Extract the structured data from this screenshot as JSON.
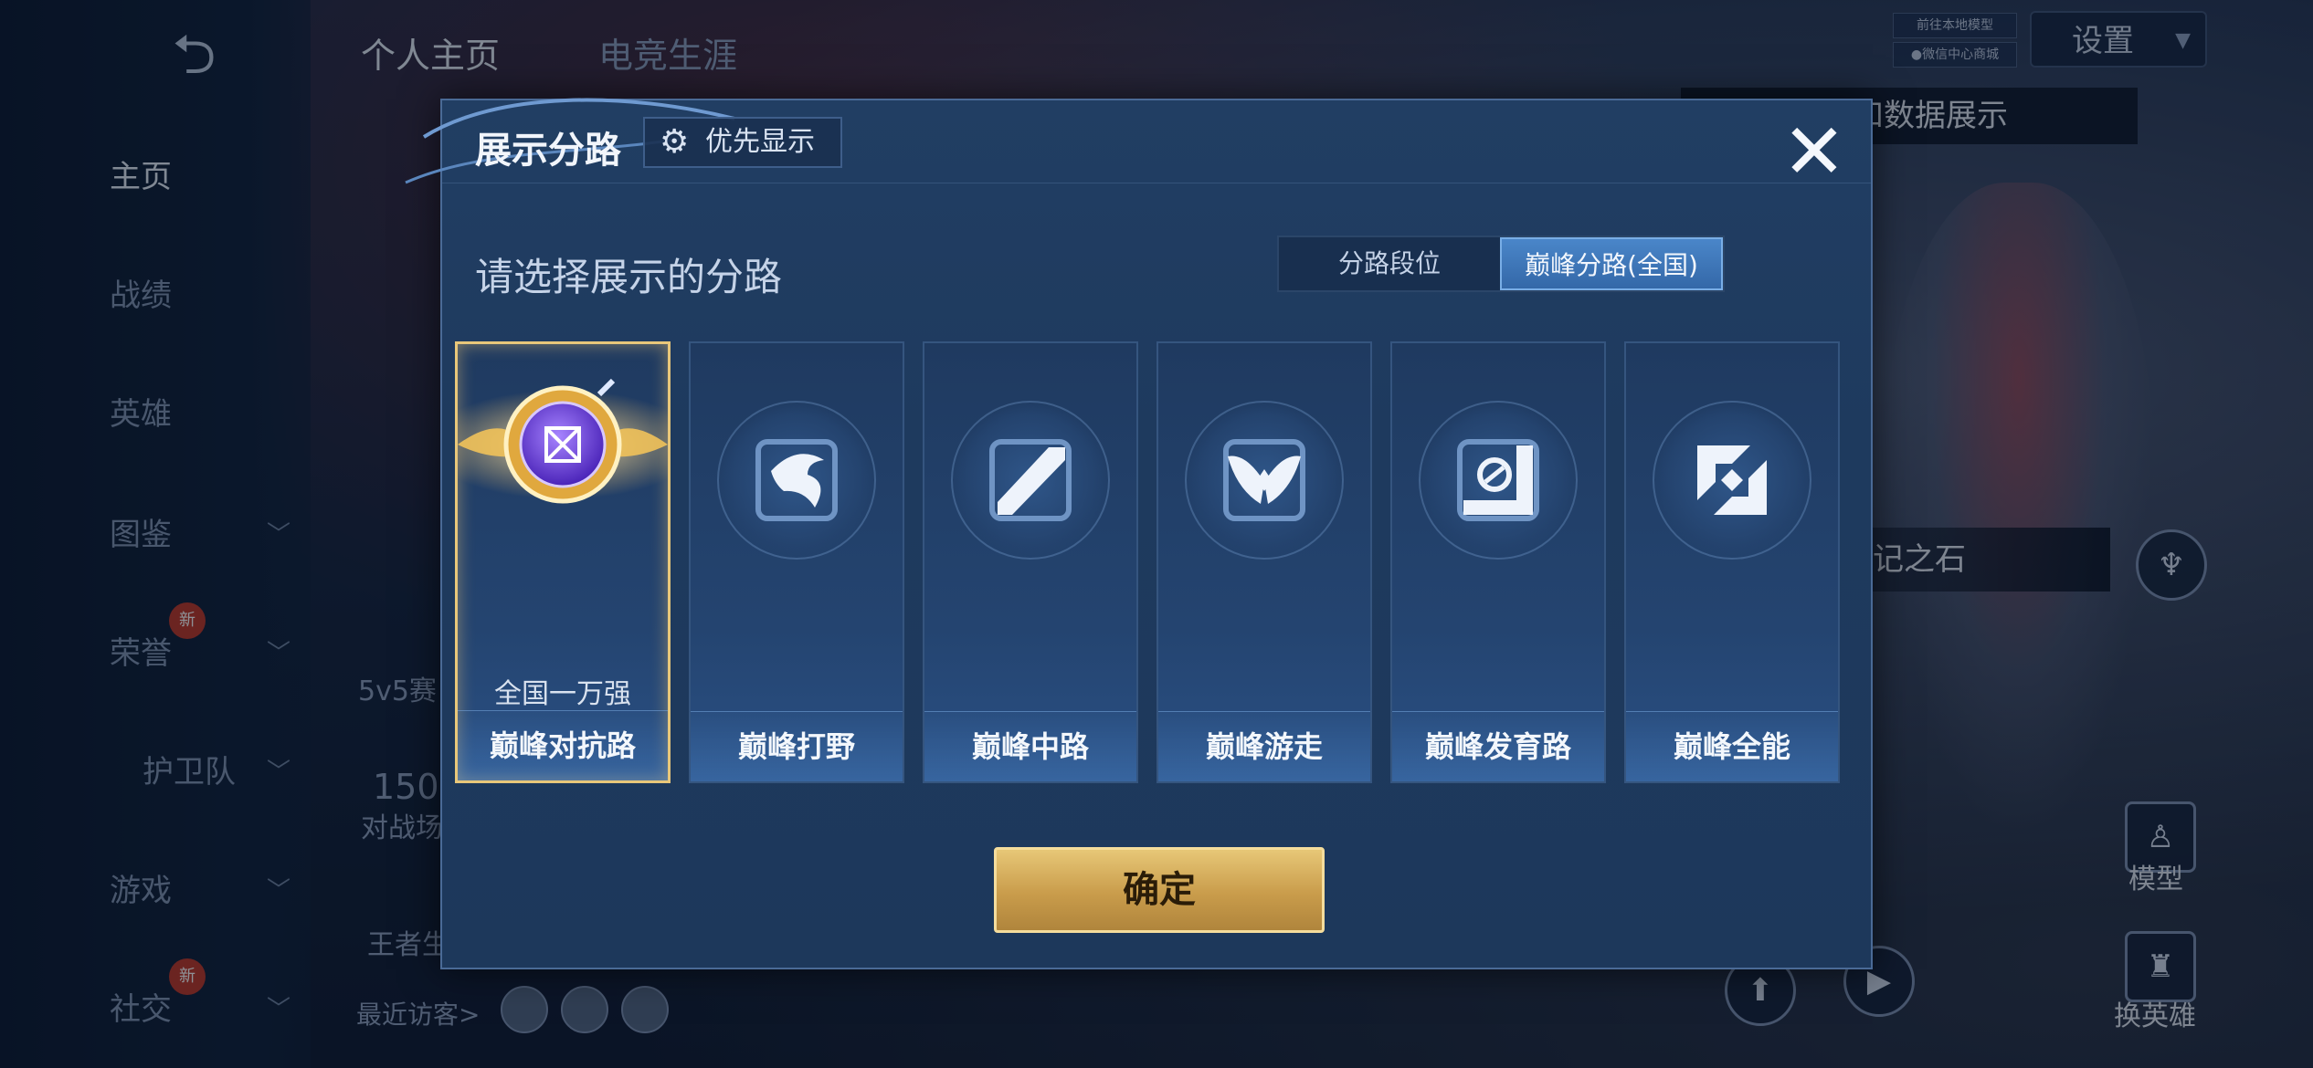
{
  "app": {
    "top_tabs": [
      "个人主页",
      "电竞生涯"
    ],
    "settings_label": "设置",
    "mini_tags": [
      "前往本地模型",
      "●微信中心商城"
    ],
    "hint_banner": "可切换灵宝和数据展示",
    "hint_mark": "点击查看铭记之石",
    "bottom_labels": {
      "model": "模型",
      "swap_hero": "换英雄"
    }
  },
  "sidebar": {
    "back_icon": "back-arrow-icon",
    "items": [
      {
        "label": "主页",
        "active": true,
        "chevron": false,
        "new": false
      },
      {
        "label": "战绩",
        "active": false,
        "chevron": false,
        "new": false
      },
      {
        "label": "英雄",
        "active": false,
        "chevron": false,
        "new": false
      },
      {
        "label": "图鉴",
        "active": false,
        "chevron": true,
        "new": false
      },
      {
        "label": "荣誉",
        "active": false,
        "chevron": true,
        "new": true
      },
      {
        "label": "护卫队",
        "active": false,
        "chevron": true,
        "new": false
      },
      {
        "label": "游戏",
        "active": false,
        "chevron": true,
        "new": false
      },
      {
        "label": "社交",
        "active": false,
        "chevron": true,
        "new": true
      }
    ],
    "new_badge": "新"
  },
  "profile_fragments": {
    "mode": "5v5赛",
    "count": "150",
    "battles": "对战场",
    "king": "王者生",
    "recent_visitors": "最近访客>"
  },
  "modal": {
    "title": "展示分路",
    "priority_label": "优先显示",
    "close_icon": "close-icon",
    "prompt": "请选择展示的分路",
    "toggle": {
      "option_a": "分路段位",
      "option_b": "巅峰分路(全国)",
      "selected": "巅峰分路(全国)"
    },
    "lanes": [
      {
        "label": "巅峰对抗路",
        "rank": "全国一万强",
        "selected": true,
        "icon": "clash-lane-icon"
      },
      {
        "label": "巅峰打野",
        "rank": "",
        "selected": false,
        "icon": "jungle-dragon-icon"
      },
      {
        "label": "巅峰中路",
        "rank": "",
        "selected": false,
        "icon": "mid-lane-icon"
      },
      {
        "label": "巅峰游走",
        "rank": "",
        "selected": false,
        "icon": "roam-wings-icon"
      },
      {
        "label": "巅峰发育路",
        "rank": "",
        "selected": false,
        "icon": "farm-lane-icon"
      },
      {
        "label": "巅峰全能",
        "rank": "",
        "selected": false,
        "icon": "all-round-icon"
      }
    ],
    "confirm_label": "确定"
  },
  "colors": {
    "accent_gold": "#e8c77a",
    "toggle_active": "#3f7bbf",
    "modal_bg": "#1f3b60"
  }
}
